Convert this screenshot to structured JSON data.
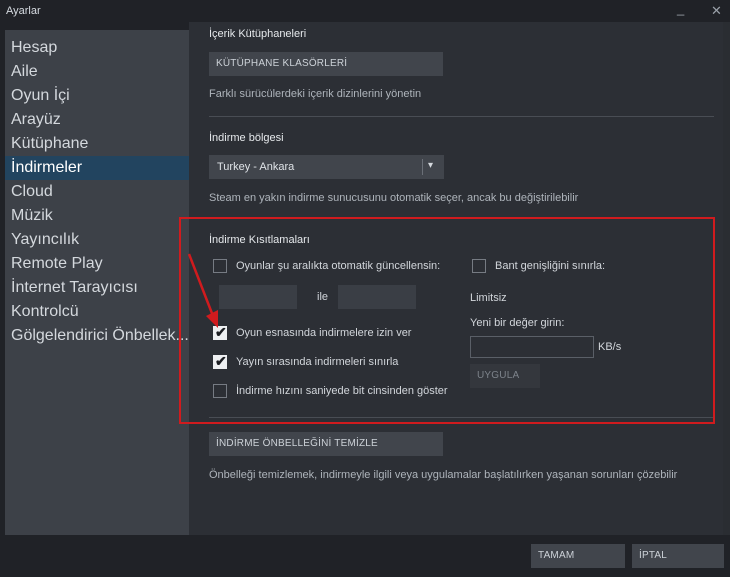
{
  "window": {
    "title": "Ayarlar",
    "minimize_glyph": "_",
    "close_glyph": "✕"
  },
  "sidebar": {
    "items": [
      {
        "label": "Hesap"
      },
      {
        "label": "Aile"
      },
      {
        "label": "Oyun İçi"
      },
      {
        "label": "Arayüz"
      },
      {
        "label": "Kütüphane"
      },
      {
        "label": "İndirmeler",
        "active": true
      },
      {
        "label": "Cloud"
      },
      {
        "label": "Müzik"
      },
      {
        "label": "Yayıncılık"
      },
      {
        "label": "Remote Play"
      },
      {
        "label": "İnternet Tarayıcısı"
      },
      {
        "label": "Kontrolcü"
      },
      {
        "label": "Gölgelendirici Önbellek..."
      }
    ]
  },
  "content_libraries": {
    "heading": "İçerik Kütüphaneleri",
    "button_label": "KÜTÜPHANE KLASÖRLERİ",
    "description": "Farklı sürücülerdeki içerik dizinlerini yönetin"
  },
  "download_region": {
    "heading": "İndirme bölgesi",
    "selected": "Turkey - Ankara",
    "description": "Steam en yakın indirme sunucusunu otomatik seçer, ancak bu değiştirilebilir"
  },
  "download_restrictions": {
    "heading": "İndirme Kısıtlamaları",
    "auto_update_label": "Oyunlar şu aralıkta otomatik güncellensin:",
    "auto_update_checked": false,
    "time_start": "",
    "time_between": "ile",
    "time_end": "",
    "allow_during_play_label": "Oyun esnasında indirmelere izin ver",
    "allow_during_play_checked": true,
    "throttle_streaming_label": "Yayın sırasında indirmeleri sınırla",
    "throttle_streaming_checked": true,
    "bits_label": "İndirme hızını saniyede bit cinsinden göster",
    "bits_checked": false,
    "bandwidth_label": "Bant genişliğini sınırla:",
    "bandwidth_checked": false,
    "current_limit": "Limitsiz",
    "new_value_label": "Yeni bir değer girin:",
    "new_value": "",
    "unit": "KB/s",
    "apply_label": "UYGULA",
    "checkmark_glyph": "✔"
  },
  "clear_cache": {
    "button_label": "İNDİRME ÖNBELLEĞİNİ TEMİZLE",
    "description": "Önbelleği temizlemek, indirmeyle ilgili veya uygulamalar başlatılırken yaşanan sorunları çözebilir"
  },
  "footer": {
    "ok_label": "TAMAM",
    "cancel_label": "İPTAL"
  },
  "colors": {
    "accent_highlight": "#d01b1e",
    "selected_sidebar": "#22445f",
    "panel": "#2c2f35"
  }
}
